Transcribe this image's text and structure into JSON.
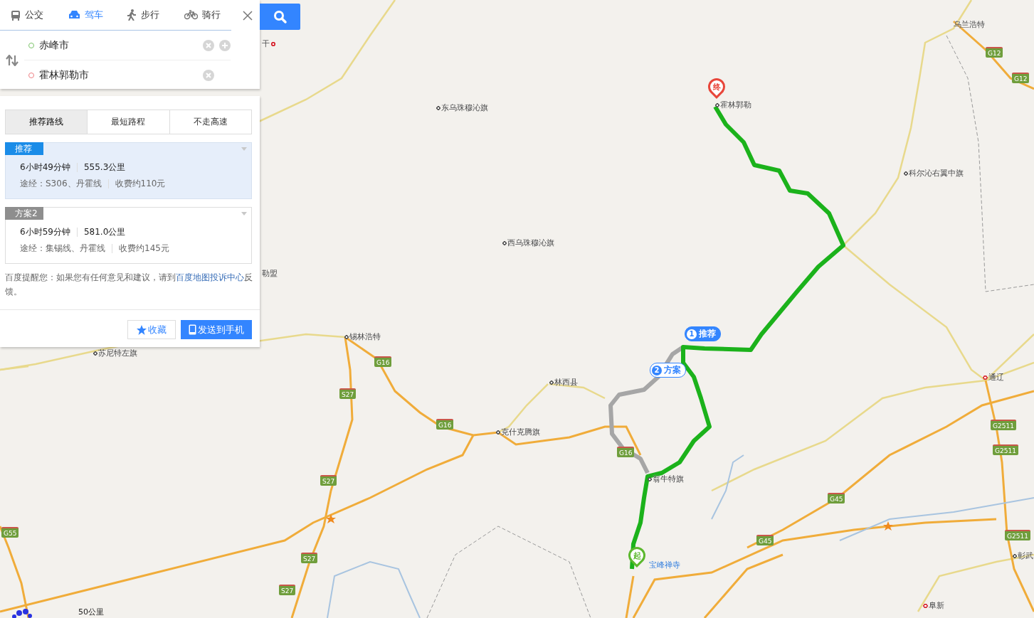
{
  "mode_tabs": [
    {
      "label": "公交",
      "selected": false
    },
    {
      "label": "驾车",
      "selected": true
    },
    {
      "label": "步行",
      "selected": false
    },
    {
      "label": "骑行",
      "selected": false
    }
  ],
  "route_inputs": [
    {
      "kind": "start",
      "value": "赤峰市"
    },
    {
      "kind": "end",
      "value": "霍林郭勒市"
    }
  ],
  "route_tabs": [
    {
      "label": "推荐路线",
      "selected": true
    },
    {
      "label": "最短路程",
      "selected": false
    },
    {
      "label": "不走高速",
      "selected": false
    }
  ],
  "routes": [
    {
      "badge": "推荐",
      "selected": true,
      "duration": "6小时49分钟",
      "distance": "555.3公里",
      "via": "途经：S306、丹霍线",
      "toll": "收费约110元"
    },
    {
      "badge": "方案2",
      "selected": false,
      "duration": "6小时59分钟",
      "distance": "581.0公里",
      "via": "途经：集锡线、丹霍线",
      "toll": "收费约145元"
    }
  ],
  "notice": {
    "text": "百度提醒您：如果您有任何意见和建议，请到",
    "link": "百度地图投诉中心",
    "tail": "反馈。"
  },
  "buttons": [
    {
      "kind": "favorite",
      "label": "收藏"
    },
    {
      "kind": "send",
      "label": "发送到手机"
    }
  ],
  "map": {
    "places": [
      {
        "name": "乌兰浩特",
        "kind": "label"
      },
      {
        "name": "东乌珠穆沁旗",
        "kind": "town"
      },
      {
        "name": "霍林郭勒",
        "kind": "town"
      },
      {
        "name": "科尔沁右翼中旗",
        "kind": "town"
      },
      {
        "name": "西乌珠穆沁旗",
        "kind": "town"
      },
      {
        "name": "勒盟",
        "kind": "label"
      },
      {
        "name": "锡林浩特",
        "kind": "town"
      },
      {
        "name": "苏尼特左旗",
        "kind": "town"
      },
      {
        "name": "林西县",
        "kind": "town"
      },
      {
        "name": "克什克腾旗",
        "kind": "town"
      },
      {
        "name": "翁牛特旗",
        "kind": "town"
      },
      {
        "name": "宝峰禅寺",
        "kind": "poi"
      },
      {
        "name": "通辽",
        "kind": "city"
      },
      {
        "name": "彰武",
        "kind": "town"
      },
      {
        "name": "阜新",
        "kind": "city"
      },
      {
        "name": "干",
        "kind": "city"
      }
    ],
    "shields": [
      "G16",
      "G16",
      "G16",
      "S27",
      "S27",
      "S27",
      "S27",
      "G55",
      "G12",
      "G12",
      "G2511",
      "G2511",
      "G2511",
      "G45",
      "G45"
    ],
    "route_markers": [
      {
        "number": "1",
        "label": "推荐",
        "selected": true
      },
      {
        "number": "2",
        "label": "方案",
        "selected": false
      }
    ],
    "start_pin": "起",
    "end_pin": "终",
    "scale": "50公里"
  }
}
